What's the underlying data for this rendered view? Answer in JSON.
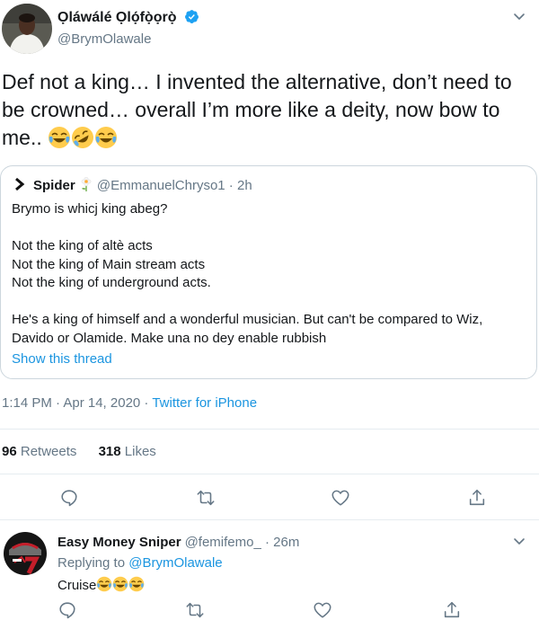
{
  "tweet": {
    "author_name": "Ọláwálé Ọlọ́fọ̀ọrọ̀",
    "author_handle": "@BrymOlawale",
    "text": "Def not a king… I invented the alternative, don’t need to be crowned… overall I’m more like a deity, now bow to me..",
    "emojis": [
      "face-with-tears-of-joy",
      "rolling-on-floor-laughing",
      "face-with-tears-of-joy"
    ],
    "timestamp": "1:14 PM · Apr 14, 2020",
    "separator": " · ",
    "source": "Twitter for iPhone",
    "retweets_count": "96",
    "retweets_label": "Retweets",
    "likes_count": "318",
    "likes_label": "Likes"
  },
  "quote": {
    "author_name": "Spider",
    "author_handle": "@EmmanuelChryso1",
    "time_sep": " · ",
    "time": "2h",
    "lines": [
      "Brymo is whicj king abeg?",
      "",
      "Not the king of altè acts",
      "Not the king of Main stream acts",
      "Not the king of underground acts.",
      "",
      "He's a king of himself and a wonderful musician. But can't be compared to Wiz, Davido or Olamide. Make una no dey enable rubbish"
    ],
    "show_thread": "Show this thread"
  },
  "reply": {
    "author_name": "Easy Money Sniper",
    "author_handle": "@femifemo_",
    "time_sep": " · ",
    "time": "26m",
    "replying_prefix": "Replying to ",
    "replying_to": "@BrymOlawale",
    "text": "Cruise",
    "emojis": [
      "face-with-tears-of-joy",
      "face-with-tears-of-joy",
      "face-with-tears-of-joy"
    ]
  },
  "actions": [
    "reply",
    "retweet",
    "like",
    "share"
  ],
  "colors": {
    "text": "#14171a",
    "secondary": "#657786",
    "link": "#1b95e0",
    "verified": "#1da1f2",
    "border": "#ccd6dd",
    "divider": "#e6ecf0"
  }
}
